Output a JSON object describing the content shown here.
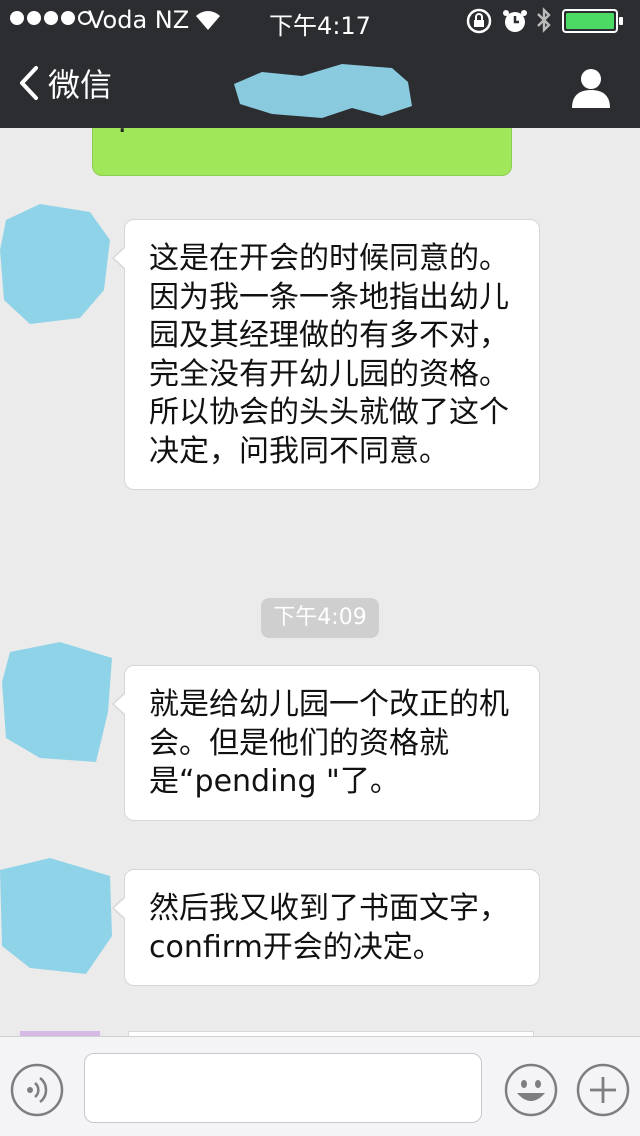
{
  "status_bar": {
    "carrier": "Voda NZ",
    "time": "下午4:17",
    "battery_color": "#4cd964"
  },
  "nav": {
    "back_label": "微信",
    "title_redacted": true
  },
  "messages": [
    {
      "direction": "out",
      "text": "?"
    },
    {
      "direction": "in",
      "text": "这是在开会的时候同意的。因为我一条一条地指出幼儿园及其经理做的有多不对，完全没有开幼儿园的资格。所以协会的头头就做了这个决定，问我同不同意。"
    },
    {
      "direction": "in",
      "text": "就是给幼儿园一个改正的机会。但是他们的资格就是“pending \"了。"
    },
    {
      "direction": "in",
      "text": "然后我又收到了书面文字，confirm开会的决定。"
    }
  ],
  "timestamp": "下午4:09",
  "input": {
    "placeholder": "",
    "value": ""
  },
  "colors": {
    "nav_bg": "#2b2d31",
    "chat_bg": "#ebebeb",
    "outgoing_bubble": "#a0e75a",
    "redaction": "#8fd3e8"
  },
  "icons": [
    "signal-dots-icon",
    "wifi-icon",
    "rotation-lock-icon",
    "alarm-icon",
    "bluetooth-icon",
    "battery-icon",
    "back-chevron-icon",
    "profile-icon",
    "voice-icon",
    "emoji-icon",
    "plus-icon"
  ]
}
